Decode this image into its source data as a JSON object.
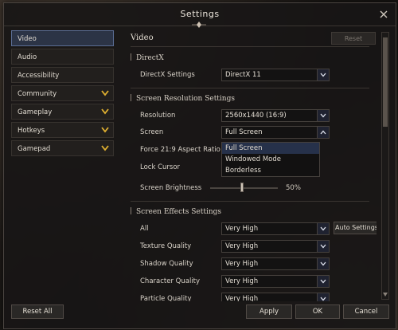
{
  "window": {
    "title": "Settings"
  },
  "sidebar": {
    "items": [
      {
        "label": "Video",
        "expandable": false,
        "active": true
      },
      {
        "label": "Audio",
        "expandable": false
      },
      {
        "label": "Accessibility",
        "expandable": false
      },
      {
        "label": "Community",
        "expandable": true
      },
      {
        "label": "Gameplay",
        "expandable": true
      },
      {
        "label": "Hotkeys",
        "expandable": true
      },
      {
        "label": "Gamepad",
        "expandable": true
      }
    ]
  },
  "content": {
    "heading": "Video",
    "reset_label": "Reset",
    "directx": {
      "section_title": "DirectX",
      "settings_label": "DirectX Settings",
      "settings_value": "DirectX 11"
    },
    "resolution": {
      "section_title": "Screen Resolution Settings",
      "resolution_label": "Resolution",
      "resolution_value": "2560x1440 (16:9)",
      "screen_label": "Screen",
      "screen_value": "Full Screen",
      "screen_options": [
        "Full Screen",
        "Windowed Mode",
        "Borderless"
      ],
      "aspect_label": "Force 21:9 Aspect Ratio",
      "lock_cursor_label": "Lock Cursor",
      "brightness_label": "Screen Brightness",
      "brightness_value": "50%",
      "brightness_level": 0.5
    },
    "effects": {
      "section_title": "Screen Effects Settings",
      "all_label": "All",
      "all_value": "Very High",
      "auto_settings_label": "Auto Settings",
      "texture_label": "Texture Quality",
      "texture_value": "Very High",
      "shadow_label": "Shadow Quality",
      "shadow_value": "Very High",
      "character_label": "Character Quality",
      "character_value": "Very High",
      "particle_label": "Particle Quality",
      "particle_value": "Very High"
    }
  },
  "footer": {
    "reset_all": "Reset All",
    "apply": "Apply",
    "ok": "OK",
    "cancel": "Cancel"
  },
  "colors": {
    "accent": "#e0b030",
    "active_item": "#2c3446",
    "selected_option": "#26314a"
  },
  "icons": {
    "close": "close-icon",
    "chevron": "chevron-down-icon",
    "ornament": "diamond-ornament"
  }
}
